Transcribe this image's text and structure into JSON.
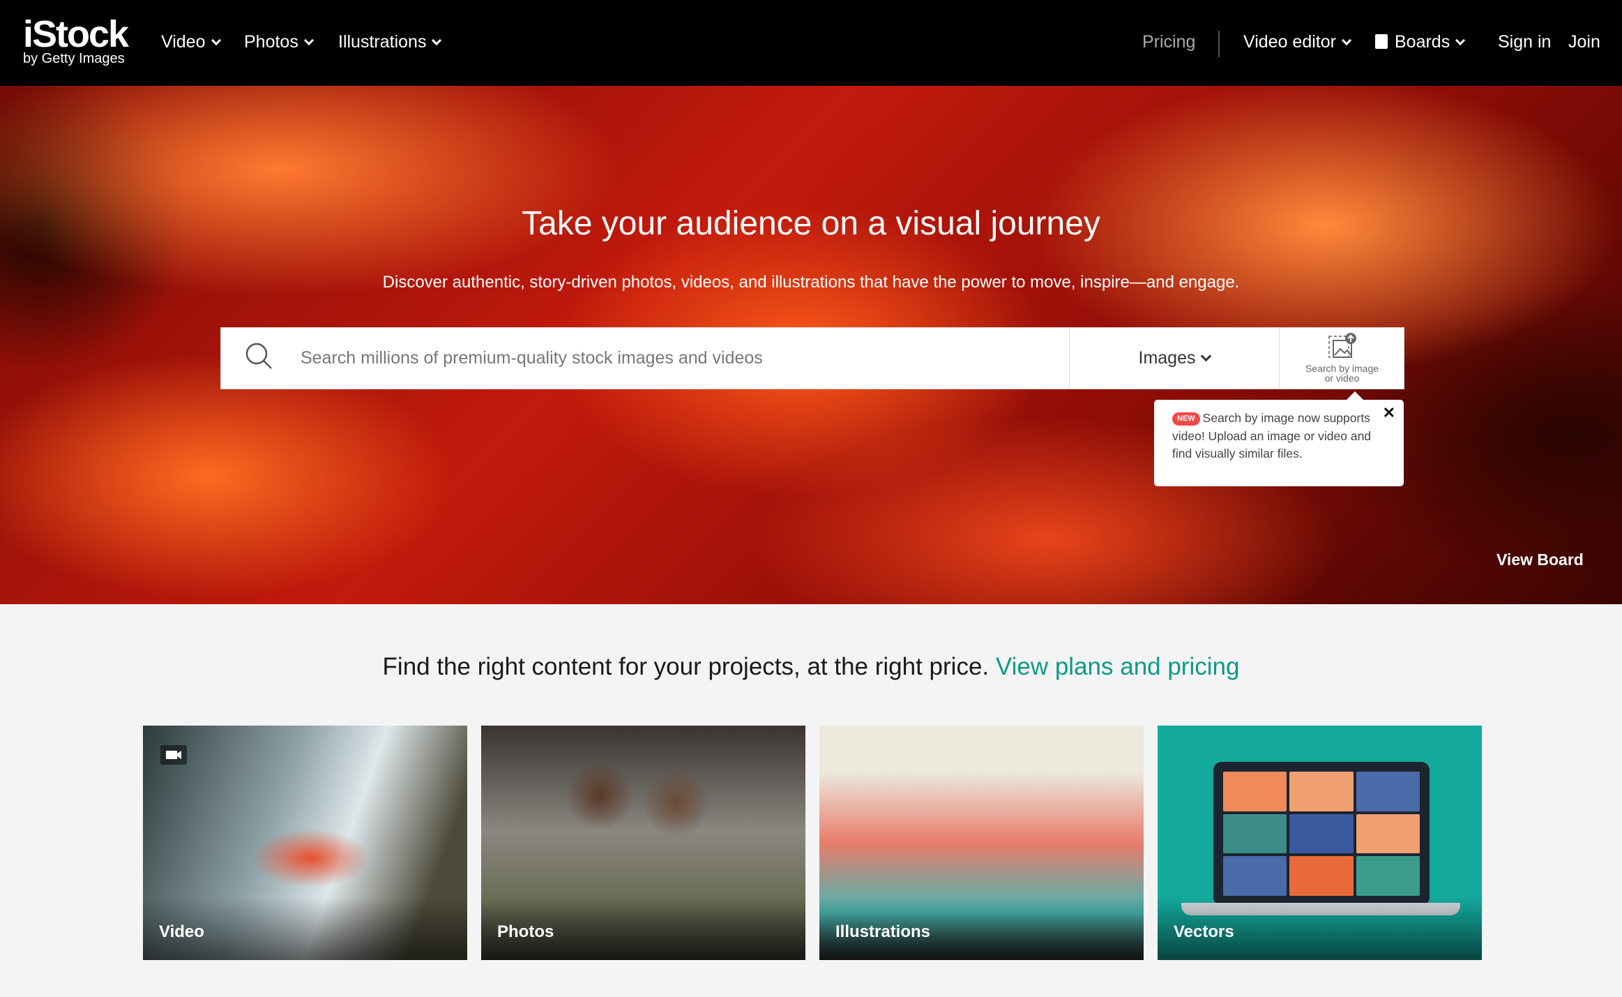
{
  "nav": {
    "logo": {
      "main": "iStock",
      "sub": "by Getty Images"
    },
    "menu": [
      {
        "label": "Video"
      },
      {
        "label": "Photos"
      },
      {
        "label": "Illustrations"
      }
    ],
    "pricing": "Pricing",
    "video_editor": "Video editor",
    "boards": "Boards",
    "sign_in": "Sign in",
    "join": "Join"
  },
  "hero": {
    "title": "Take your audience on a visual journey",
    "subtitle": "Discover authentic, story-driven photos, videos, and illustrations that have the power to move, inspire—and engage.",
    "search": {
      "placeholder": "Search millions of premium-quality stock images and videos",
      "type": "Images",
      "image_search_label_1": "Search by image",
      "image_search_label_2": "or video"
    },
    "tooltip": {
      "badge": "NEW",
      "text": "Search by image now supports video! Upload an image or video and find visually similar files."
    },
    "view_board": "View Board"
  },
  "tagline": {
    "text": "Find the right content for your projects, at the right price. ",
    "link": "View plans and pricing",
    "link_color": "#0c9a87"
  },
  "cards": [
    {
      "label": "Video"
    },
    {
      "label": "Photos"
    },
    {
      "label": "Illustrations"
    },
    {
      "label": "Vectors"
    }
  ]
}
